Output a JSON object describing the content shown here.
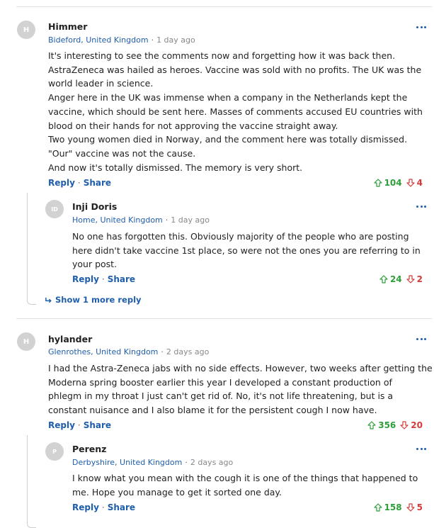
{
  "comments": [
    {
      "initial": "H",
      "name": "Himmer",
      "location": "Bideford, United Kingdom",
      "time": "1 day ago",
      "lines": [
        "It's interesting to see the comments now and forgetting how it was back then.",
        "AstraZeneca was hailed as heroes. Vaccine was sold with no profits. The UK was the",
        "world leader in science.",
        "Anger here in the UK was  immense when a company in the Netherlands kept the",
        "vaccine, which should be sent here.  Masses of comments accused EU countries with",
        "blood on their hands for  not approving the vaccine straight away.",
        "Two young women died in Norway, and the comment here was totally dismissed.",
        "\"Our\" vaccine was not the cause.",
        "And now it's totally dismissed. The memory is very short."
      ],
      "reply_label": "Reply",
      "share_label": "Share",
      "upvotes": "104",
      "downvotes": "4"
    },
    {
      "initial": "ID",
      "name": "Inji Doris",
      "location": "Home, United Kingdom",
      "time": "1 day ago",
      "lines": [
        "No one has forgotten this. Obviously majority of the people who are posting",
        "here didn't take vaccine 1st place, so were not the ones you are referring to in",
        "your post."
      ],
      "reply_label": "Reply",
      "share_label": "Share",
      "upvotes": "24",
      "downvotes": "2"
    },
    {
      "initial": "H",
      "name": "hylander",
      "location": "Glenrothes, United Kingdom",
      "time": "2 days ago",
      "lines": [
        "I had the Astra-Zeneca jabs with no side effects. However, two weeks after getting the",
        "Moderna spring  booster earlier this year I developed a constant production of",
        "phlegm in my throat I just can't get rid of. No, it's not life threatening, but is a",
        "constant nuisance and I also blame it for the persistent cough I now have."
      ],
      "reply_label": "Reply",
      "share_label": "Share",
      "upvotes": "356",
      "downvotes": "20"
    },
    {
      "initial": "P",
      "name": "Perenz",
      "location": "Derbyshire, United Kingdom",
      "time": "2 days ago",
      "lines": [
        " I know what you mean with the cough it is one of the things that happened to",
        "me. Hope you manage to get it sorted one day."
      ],
      "reply_label": "Reply",
      "share_label": "Share",
      "upvotes": "158",
      "downvotes": "5"
    }
  ],
  "show_more_label": "Show 1 more reply",
  "colors": {
    "link": "#1f5eac",
    "upvote": "#2f9e3a",
    "downvote": "#d43a3a",
    "avatar": "#d2d2d2"
  },
  "icons": {
    "more": "more-options-icon",
    "up": "arrow-up-icon",
    "down": "arrow-down-icon",
    "reply_arrow": "reply-arrow-icon"
  }
}
